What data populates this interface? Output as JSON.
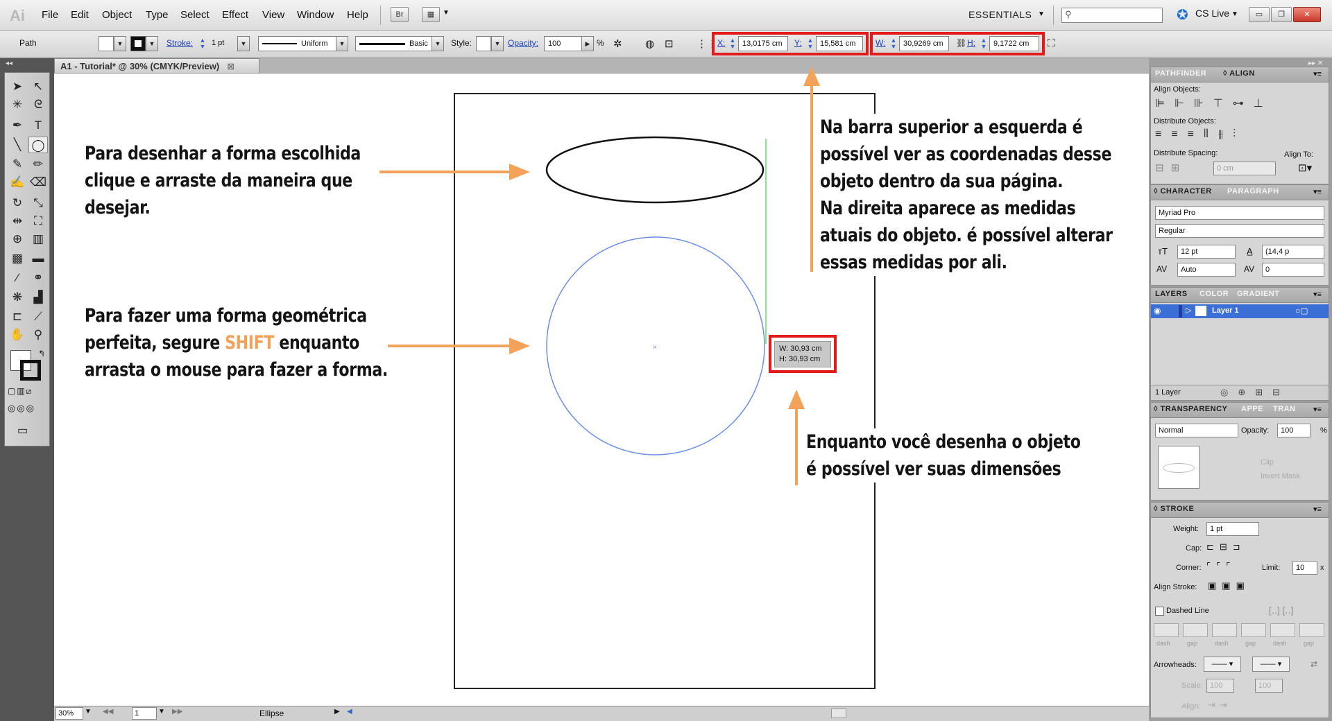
{
  "app": {
    "logo": "Ai"
  },
  "menu": {
    "items": [
      "File",
      "Edit",
      "Object",
      "Type",
      "Select",
      "Effect",
      "View",
      "Window",
      "Help"
    ]
  },
  "menubar": {
    "bridge_label": "Br",
    "workspace": "ESSENTIALS",
    "cs_live": "CS Live"
  },
  "control": {
    "selection_type": "Path",
    "stroke_label": "Stroke:",
    "stroke_value": "1 pt",
    "profile": "Uniform",
    "brush": "Basic",
    "style_label": "Style:",
    "opacity_label": "Opacity:",
    "opacity_value": "100",
    "percent": "%",
    "x_label": "X:",
    "x_value": "13,0175 cm",
    "y_label": "Y:",
    "y_value": "15,581 cm",
    "w_label": "W:",
    "w_value": "30,9269 cm",
    "h_label": "H:",
    "h_value": "9,1722 cm"
  },
  "document": {
    "tab_title": "A1 - Tutorial* @ 30% (CMYK/Preview)"
  },
  "tooltip": {
    "w": "W: 30,93 cm",
    "h": "H: 30,93 cm"
  },
  "annotations": {
    "left1": [
      "Para desenhar a forma escolhida",
      "clique e arraste da maneira que",
      "desejar."
    ],
    "left2_line1": "Para fazer uma forma geométrica",
    "left2_line2_pre": "perfeita, segure ",
    "left2_line2_hl": "SHIFT",
    "left2_line2_post": " enquanto",
    "left2_line3": "arrasta o mouse para fazer a forma.",
    "right1": [
      "Na barra superior a esquerda é",
      "possível ver as coordenadas desse",
      "objeto dentro da sua página.",
      "Na direita aparece as medidas",
      "atuais do objeto. é possível alterar",
      "essas medidas por ali."
    ],
    "right2": [
      "Enquanto você desenha o objeto",
      "é possível ver suas dimensões"
    ]
  },
  "status": {
    "zoom": "30%",
    "page": "1",
    "tool": "Ellipse"
  },
  "panels": {
    "align": {
      "tabs": [
        "PATHFINDER",
        "◊ ALIGN"
      ],
      "align_objects": "Align Objects:",
      "distribute_objects": "Distribute Objects:",
      "distribute_spacing": "Distribute Spacing:",
      "align_to": "Align To:",
      "spacing_value": "0 cm"
    },
    "character": {
      "tabs": [
        "◊ CHARACTER",
        "PARAGRAPH"
      ],
      "font": "Myriad Pro",
      "style": "Regular",
      "size": "12 pt",
      "leading": "(14,4 p",
      "kerning": "Auto",
      "tracking": "0"
    },
    "layers": {
      "tabs": [
        "LAYERS",
        "COLOR",
        "GRADIENT"
      ],
      "layer_name": "Layer 1",
      "count": "1 Layer"
    },
    "transparency": {
      "tabs": [
        "◊ TRANSPARENCY",
        "APPE",
        "TRAN"
      ],
      "mode": "Normal",
      "opacity_label": "Opacity:",
      "opacity_value": "100",
      "percent": "%",
      "clip": "Clip",
      "invert_mask": "Invert Mask"
    },
    "stroke": {
      "tab": "◊ STROKE",
      "weight_label": "Weight:",
      "weight_value": "1 pt",
      "cap_label": "Cap:",
      "corner_label": "Corner:",
      "limit_label": "Limit:",
      "limit_value": "10",
      "limit_unit": "x",
      "align_stroke_label": "Align Stroke:",
      "dashed_line": "Dashed Line",
      "dash_labels": [
        "dash",
        "gap",
        "dash",
        "gap",
        "dash",
        "gap"
      ],
      "arrowheads": "Arrowheads:",
      "scale_label": "Scale:",
      "scale_value1": "100",
      "scale_value2": "100",
      "align_label": "Align:"
    }
  },
  "colors": {
    "accent_red": "#e31b1b",
    "arrow_orange": "#f3a25a",
    "highlight_orange": "#f3a25a",
    "smart_guide": "#6fd66f",
    "selection_blue": "#6d8fe0"
  }
}
